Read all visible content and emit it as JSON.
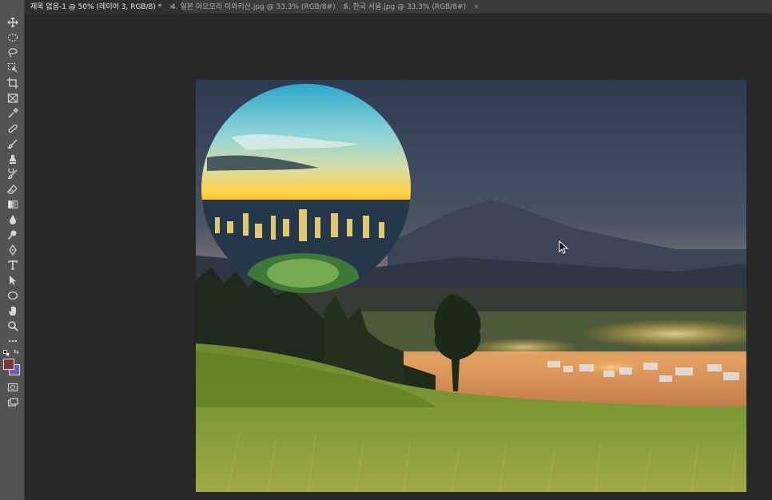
{
  "tabs": [
    {
      "label": "제목 없음-1 @ 50% (레이어 3, RGB/8) *",
      "close": "×"
    },
    {
      "label": "4. 일본 아오모리 이와키산.jpg @ 33.3% (RGB/8#)",
      "close": "×"
    },
    {
      "label": "5. 한국 서울.jpg @ 33.3% (RGB/8#)",
      "close": "×"
    }
  ],
  "tools": [
    {
      "name": "move-tool",
      "icon": "move-icon"
    },
    {
      "name": "ellipse-marquee-tool",
      "icon": "ellipse-marquee-icon"
    },
    {
      "name": "lasso-tool",
      "icon": "lasso-icon"
    },
    {
      "name": "object-selection-tool",
      "icon": "object-selection-icon"
    },
    {
      "name": "crop-tool",
      "icon": "crop-icon"
    },
    {
      "name": "frame-tool",
      "icon": "frame-icon"
    },
    {
      "name": "eyedropper-tool",
      "icon": "eyedropper-icon"
    },
    {
      "name": "healing-brush-tool",
      "icon": "healing-brush-icon"
    },
    {
      "name": "brush-tool",
      "icon": "brush-icon"
    },
    {
      "name": "clone-stamp-tool",
      "icon": "stamp-icon"
    },
    {
      "name": "history-brush-tool",
      "icon": "history-brush-icon"
    },
    {
      "name": "eraser-tool",
      "icon": "eraser-icon"
    },
    {
      "name": "gradient-tool",
      "icon": "gradient-icon"
    },
    {
      "name": "blur-tool",
      "icon": "blur-drop-icon"
    },
    {
      "name": "dodge-tool",
      "icon": "dodge-icon"
    },
    {
      "name": "pen-tool",
      "icon": "pen-icon"
    },
    {
      "name": "type-tool",
      "icon": "type-icon"
    },
    {
      "name": "path-selection-tool",
      "icon": "path-selection-icon"
    },
    {
      "name": "ellipse-tool",
      "icon": "ellipse-shape-icon"
    },
    {
      "name": "hand-tool",
      "icon": "hand-icon"
    },
    {
      "name": "zoom-tool",
      "icon": "zoom-icon"
    },
    {
      "name": "more-tools",
      "icon": "more-icon"
    }
  ],
  "colors": {
    "foreground": "#7a3a36",
    "background": "#6e5fb0",
    "accent": "#d8a13e"
  }
}
